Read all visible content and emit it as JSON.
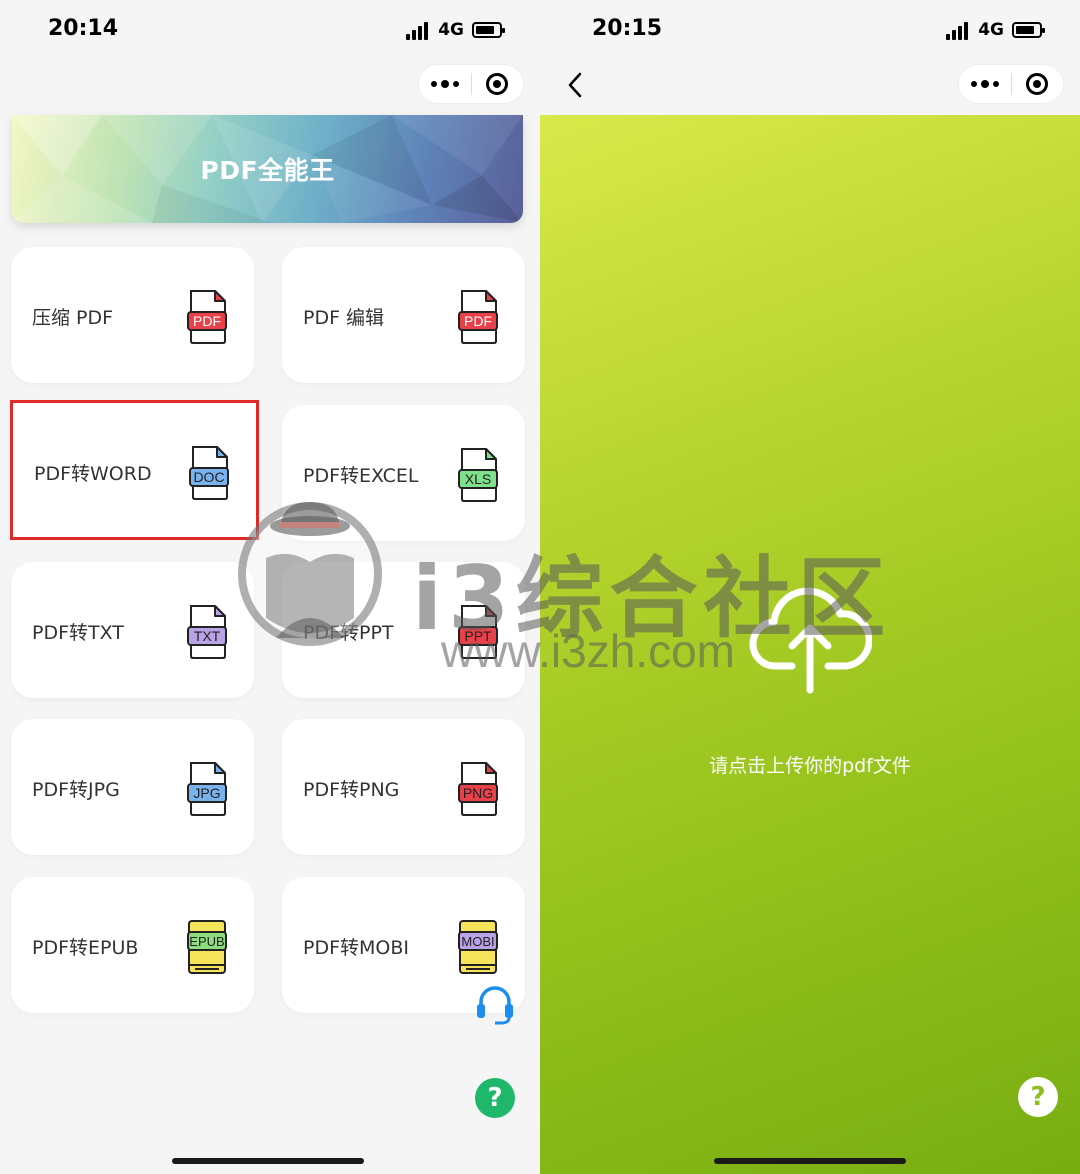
{
  "left": {
    "status": {
      "time": "20:14",
      "network": "4G"
    },
    "banner": {
      "title": "PDF全能王"
    },
    "tools": [
      {
        "label": "压缩 PDF",
        "ext": "PDF",
        "color": "#e8414a",
        "text_color": "#ffffff"
      },
      {
        "label": "PDF 编辑",
        "ext": "PDF",
        "color": "#e8414a",
        "text_color": "#ffffff"
      },
      {
        "label": "PDF转WORD",
        "ext": "DOC",
        "color": "#7ab2ee",
        "text_color": "#222222"
      },
      {
        "label": "PDF转EXCEL",
        "ext": "XLS",
        "color": "#7ee08a",
        "text_color": "#222222"
      },
      {
        "label": "PDF转TXT",
        "ext": "TXT",
        "color": "#b9a2e6",
        "text_color": "#222222"
      },
      {
        "label": "PDF转PPT",
        "ext": "PPT",
        "color": "#e8414a",
        "text_color": "#222222"
      },
      {
        "label": "PDF转JPG",
        "ext": "JPG",
        "color": "#7ab2ee",
        "text_color": "#222222"
      },
      {
        "label": "PDF转PNG",
        "ext": "PNG",
        "color": "#e8414a",
        "text_color": "#222222"
      },
      {
        "label": "PDF转EPUB",
        "ext": "EPUB",
        "color": "#8fdc7e",
        "text_color": "#222222"
      },
      {
        "label": "PDF转MOBI",
        "ext": "MOBI",
        "color": "#b9a2e6",
        "text_color": "#222222"
      }
    ],
    "help_label": "?"
  },
  "right": {
    "status": {
      "time": "20:15",
      "network": "4G"
    },
    "upload_text": "请点击上传你的pdf文件",
    "help_label": "?"
  },
  "watermark": {
    "title": "i3综合社区",
    "url": "www.i3zh.com"
  },
  "colors": {
    "highlight": "#e02a2a",
    "accent_green": "#1fb86a",
    "headset": "#1b8ef0"
  }
}
